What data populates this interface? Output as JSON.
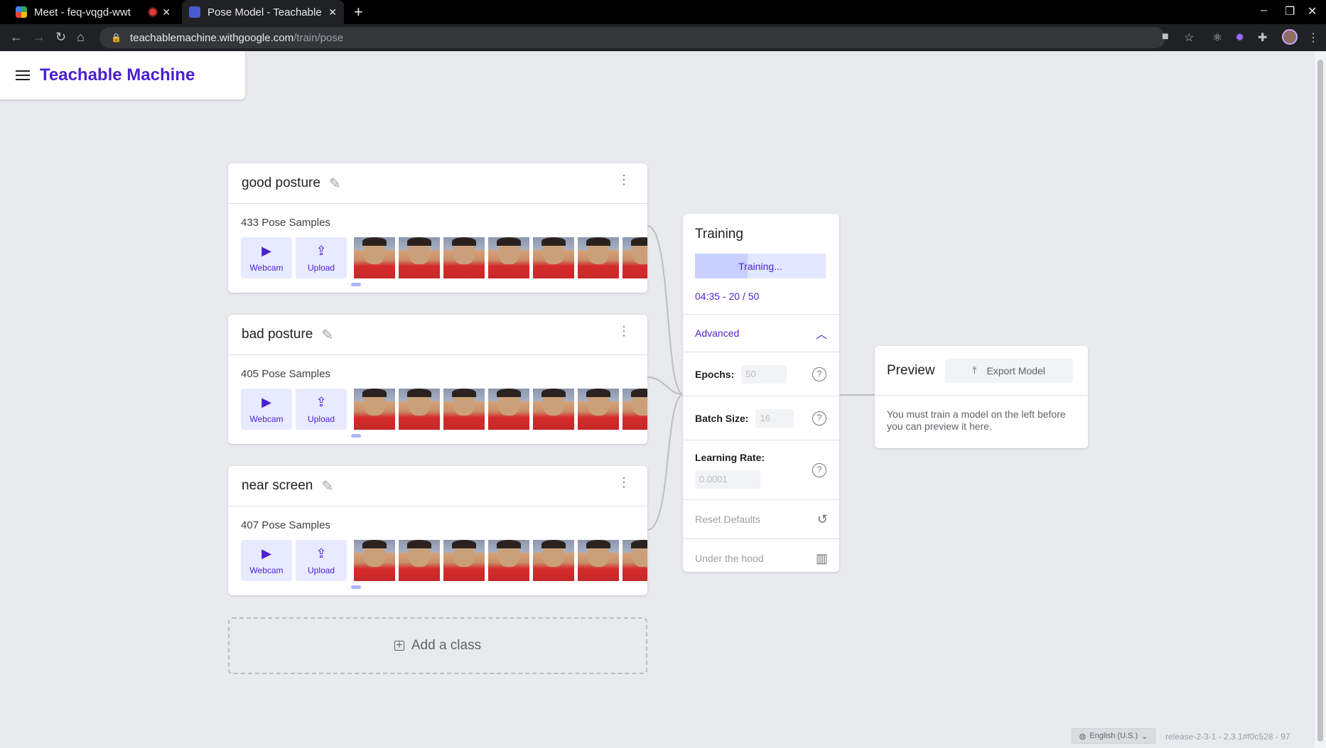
{
  "browser": {
    "tabs": [
      {
        "title": "Meet - feq-vqgd-wwt",
        "active": false
      },
      {
        "title": "Pose Model - Teachable M",
        "active": true
      }
    ],
    "url_host": "teachablemachine.withgoogle.com",
    "url_path": "/train/pose"
  },
  "header": {
    "brand": "Teachable Machine"
  },
  "classes": [
    {
      "name": "good posture",
      "samples": "433 Pose Samples",
      "webcam": "Webcam",
      "upload": "Upload"
    },
    {
      "name": "bad posture",
      "samples": "405 Pose Samples",
      "webcam": "Webcam",
      "upload": "Upload"
    },
    {
      "name": "near screen",
      "samples": "407 Pose Samples",
      "webcam": "Webcam",
      "upload": "Upload"
    }
  ],
  "add_class": "Add a class",
  "training": {
    "title": "Training",
    "button": "Training...",
    "progress_fraction": 0.4,
    "status": "04:35 - 20 / 50",
    "advanced": "Advanced",
    "epochs_label": "Epochs:",
    "epochs_value": "50",
    "batch_label": "Batch Size:",
    "batch_value": "16",
    "lr_label": "Learning Rate:",
    "lr_value": "0.0001",
    "reset": "Reset Defaults",
    "under_hood": "Under the hood"
  },
  "preview": {
    "title": "Preview",
    "export": "Export Model",
    "message": "You must train a model on the left before you can preview it here."
  },
  "footer": {
    "language": "English (U.S.)",
    "version": "release-2-3-1 - 2.3.1#f0c528 - 97"
  },
  "colors": {
    "accent": "#4a1fd1",
    "accent_light": "#e8eaff"
  }
}
